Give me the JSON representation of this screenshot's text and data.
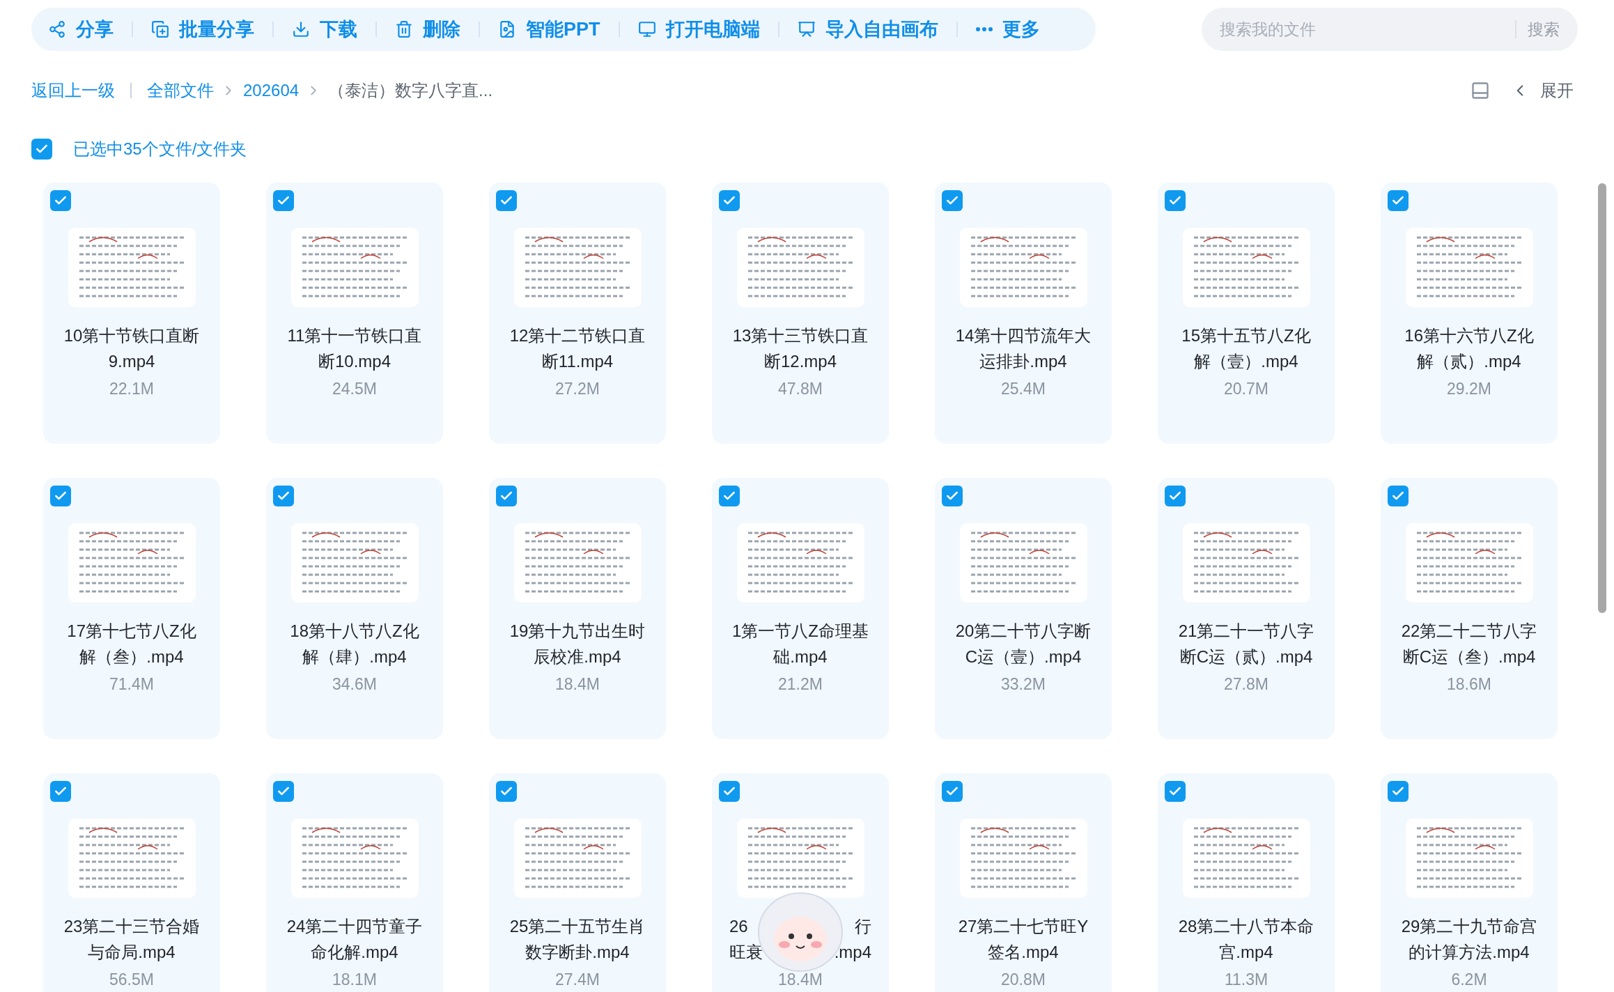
{
  "toolbar": {
    "actions": [
      {
        "label": "分享"
      },
      {
        "label": "批量分享"
      },
      {
        "label": "下载"
      },
      {
        "label": "删除"
      },
      {
        "label": "智能PPT"
      },
      {
        "label": "打开电脑端"
      },
      {
        "label": "导入自由画布"
      },
      {
        "label": "更多"
      }
    ]
  },
  "search": {
    "placeholder": "搜索我的文件",
    "button": "搜索"
  },
  "breadcrumb": {
    "back": "返回上一级",
    "path": [
      "全部文件",
      "202604",
      "（泰洁）数字八字直..."
    ]
  },
  "view_controls": {
    "expand": "展开"
  },
  "selection": {
    "selected": true,
    "label": "已选中35个文件/文件夹"
  },
  "files": [
    {
      "name": "10第十节铁口直断9.mp4",
      "size": "22.1M",
      "selected": true
    },
    {
      "name": "11第十一节铁口直断10.mp4",
      "size": "24.5M",
      "selected": true
    },
    {
      "name": "12第十二节铁口直断11.mp4",
      "size": "27.2M",
      "selected": true
    },
    {
      "name": "13第十三节铁口直断12.mp4",
      "size": "47.8M",
      "selected": true
    },
    {
      "name": "14第十四节流年大运排卦.mp4",
      "size": "25.4M",
      "selected": true
    },
    {
      "name": "15第十五节八Z化解（壹）.mp4",
      "size": "20.7M",
      "selected": true
    },
    {
      "name": "16第十六节八Z化解（贰）.mp4",
      "size": "29.2M",
      "selected": true
    },
    {
      "name": "17第十七节八Z化解（叁）.mp4",
      "size": "71.4M",
      "selected": true
    },
    {
      "name": "18第十八节八Z化解（肆）.mp4",
      "size": "34.6M",
      "selected": true
    },
    {
      "name": "19第十九节出生时辰校准.mp4",
      "size": "18.4M",
      "selected": true
    },
    {
      "name": "1第一节八Z命理基础.mp4",
      "size": "21.2M",
      "selected": true
    },
    {
      "name": "20第二十节八字断C运（壹）.mp4",
      "size": "33.2M",
      "selected": true
    },
    {
      "name": "21第二十一节八字断C运（贰）.mp4",
      "size": "27.8M",
      "selected": true
    },
    {
      "name": "22第二十二节八字断C运（叁）.mp4",
      "size": "18.6M",
      "selected": true
    },
    {
      "name": "23第二十三节合婚与命局.mp4",
      "size": "56.5M",
      "selected": true
    },
    {
      "name": "24第二十四节童子命化解.mp4",
      "size": "18.1M",
      "selected": true
    },
    {
      "name": "25第二十五节生肖数字断卦.mp4",
      "size": "27.4M",
      "selected": true
    },
    {
      "name_parts": [
        [
          "26",
          "行"
        ],
        [
          "旺衰",
          ".mp4"
        ]
      ],
      "size": "18.4M",
      "selected": true
    },
    {
      "name": "27第二十七节旺Y签名.mp4",
      "size": "20.8M",
      "selected": true
    },
    {
      "name": "28第二十八节本命宫.mp4",
      "size": "11.3M",
      "selected": true
    },
    {
      "name": "29第二十九节命宫的计算方法.mp4",
      "size": "6.2M",
      "selected": true
    }
  ]
}
